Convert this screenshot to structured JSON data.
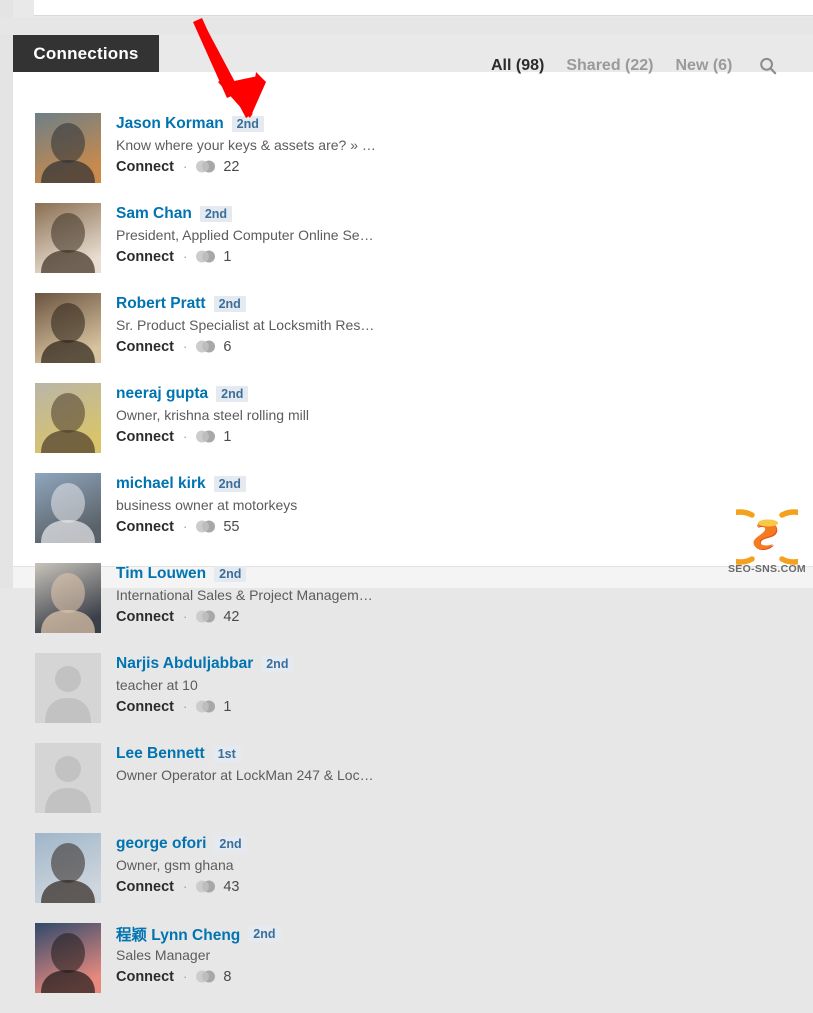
{
  "header": {
    "tab_label": "Connections"
  },
  "filters": {
    "items": [
      {
        "label": "All (98)",
        "state": "active"
      },
      {
        "label": "Shared (22)",
        "state": "inactive"
      },
      {
        "label": "New (6)",
        "state": "inactive"
      }
    ],
    "search_icon": "search-icon"
  },
  "connections": [
    {
      "name": "Jason Korman",
      "degree": "2nd",
      "headline": "Know where your keys & assets are? » …",
      "action": "Connect",
      "separator": "·",
      "shared_count": "22",
      "avatar_type": "photo",
      "avatar_colors": [
        "#6d7f87",
        "#2c2f34",
        "#c98a4b"
      ]
    },
    {
      "name": "Sam Chan",
      "degree": "2nd",
      "headline": "President, Applied Computer Online Se…",
      "action": "Connect",
      "separator": "·",
      "shared_count": "1",
      "avatar_type": "photo",
      "avatar_colors": [
        "#8a6f52",
        "#3d2f22",
        "#e8ddd0"
      ]
    },
    {
      "name": "Robert Pratt",
      "degree": "2nd",
      "headline": "Sr. Product Specialist at Locksmith Res…",
      "action": "Connect",
      "separator": "·",
      "shared_count": "6",
      "avatar_type": "photo",
      "avatar_colors": [
        "#6b5440",
        "#2a2118",
        "#d8c39f"
      ]
    },
    {
      "name": "neeraj gupta",
      "degree": "2nd",
      "headline": "Owner, krishna steel rolling mill",
      "action": "Connect",
      "separator": "·",
      "shared_count": "1",
      "avatar_type": "photo",
      "avatar_colors": [
        "#b9b5a8",
        "#4a3a2c",
        "#d9c46a"
      ]
    },
    {
      "name": "michael kirk",
      "degree": "2nd",
      "headline": "business owner at motorkeys",
      "action": "Connect",
      "separator": "·",
      "shared_count": "55",
      "avatar_type": "photo",
      "avatar_colors": [
        "#8fa6bd",
        "#e9eaec",
        "#5a6168"
      ]
    },
    {
      "name": "Tim Louwen",
      "degree": "2nd",
      "headline": "International Sales & Project Managem…",
      "action": "Connect",
      "separator": "·",
      "shared_count": "42",
      "avatar_type": "photo",
      "avatar_colors": [
        "#c8c3bb",
        "#e4c9ae",
        "#3a3f48"
      ]
    },
    {
      "name": "Narjis Abduljabbar",
      "degree": "2nd",
      "headline": "teacher at 10",
      "action": "Connect",
      "separator": "·",
      "shared_count": "1",
      "avatar_type": "placeholder",
      "avatar_colors": [
        "#d5d5d5",
        "#c4c4c4",
        "#c4c4c4"
      ]
    },
    {
      "name": "Lee Bennett",
      "degree": "1st",
      "headline": "Owner Operator at LockMan 247 & Loc…",
      "action": "",
      "separator": "",
      "shared_count": "",
      "avatar_type": "placeholder",
      "avatar_colors": [
        "#d5d5d5",
        "#c4c4c4",
        "#c4c4c4"
      ]
    },
    {
      "name": "george ofori",
      "degree": "2nd",
      "headline": "Owner, gsm ghana",
      "action": "Connect",
      "separator": "·",
      "shared_count": "43",
      "avatar_type": "photo",
      "avatar_colors": [
        "#9fb6c9",
        "#2f2520",
        "#cfd6dd"
      ]
    },
    {
      "name": "程颖 Lynn Cheng",
      "degree": "2nd",
      "headline": "Sales Manager",
      "action": "Connect",
      "separator": "·",
      "shared_count": "8",
      "avatar_type": "photo",
      "avatar_colors": [
        "#2f4a6b",
        "#1d1a18",
        "#e8897f"
      ]
    }
  ],
  "watermark": {
    "text": "SEO-SNS.COM"
  },
  "annotation": {
    "arrow_color": "#ff0000"
  }
}
